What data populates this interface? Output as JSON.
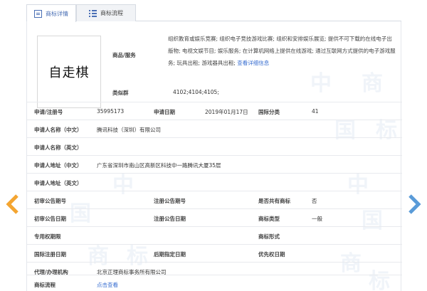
{
  "tabs": [
    {
      "label": "商标详情",
      "active": true,
      "icon": "detail-icon"
    },
    {
      "label": "商标流程",
      "active": false,
      "icon": "list-icon"
    }
  ],
  "logo_text": "自走棋",
  "goods": {
    "label": "商品/服务",
    "text": "组织教育或娱乐竞赛; 组织电子竞技游戏比赛; 组织和安排娱乐展览; 提供不可下载的在线电子出版物; 电视文娱节目; 娱乐服务; 在计算机网络上提供在线游戏; 通过互联网方式提供的电子游戏服务; 玩具出租; 游戏器具出租;",
    "link": "查看详细信息"
  },
  "similar": {
    "label": "类似群",
    "value": "4102;4104;4105;"
  },
  "details": {
    "reg_no_label": "申请/注册号",
    "reg_no": "35995173",
    "app_date_label": "申请日期",
    "app_date": "2019年01月17日",
    "intl_class_label": "国际分类",
    "intl_class": "41",
    "applicant_cn_label": "申请人名称（中文）",
    "applicant_cn": "腾讯科技（深圳）有限公司",
    "applicant_en_label": "申请人名称（英文）",
    "applicant_en": "",
    "address_cn_label": "申请人地址（中文）",
    "address_cn": "广东省深圳市南山区高新区科技中一路腾讯大厦35层",
    "address_en_label": "申请人地址（英文）",
    "address_en": "",
    "prelim_no_label": "初审公告期号",
    "prelim_no": "",
    "reg_pub_no_label": "注册公告期号",
    "reg_pub_no": "",
    "shared_label": "是否共有商标",
    "shared": "否",
    "prelim_date_label": "初审公告日期",
    "prelim_date": "",
    "reg_pub_date_label": "注册公告日期",
    "reg_pub_date": "",
    "tm_type_label": "商标类型",
    "tm_type": "一般",
    "exclusive_label": "专用权期限",
    "exclusive": "",
    "tm_form_label": "商标形式",
    "tm_form": "",
    "intl_reg_date_label": "国际注册日期",
    "intl_reg_date": "",
    "later_date_label": "后期指定日期",
    "later_date": "",
    "priority_label": "优先权日期",
    "priority": "",
    "agent_label": "代理/办理机构",
    "agent": "北京正理商标事务所有限公司",
    "process_label": "商标流程",
    "process_link": "点击查看"
  },
  "watermark": [
    "中",
    "国",
    "商",
    "标"
  ],
  "colors": {
    "arrow_left": "#f4a531",
    "arrow_right": "#5a9bd8",
    "link": "#3a6fd1"
  }
}
